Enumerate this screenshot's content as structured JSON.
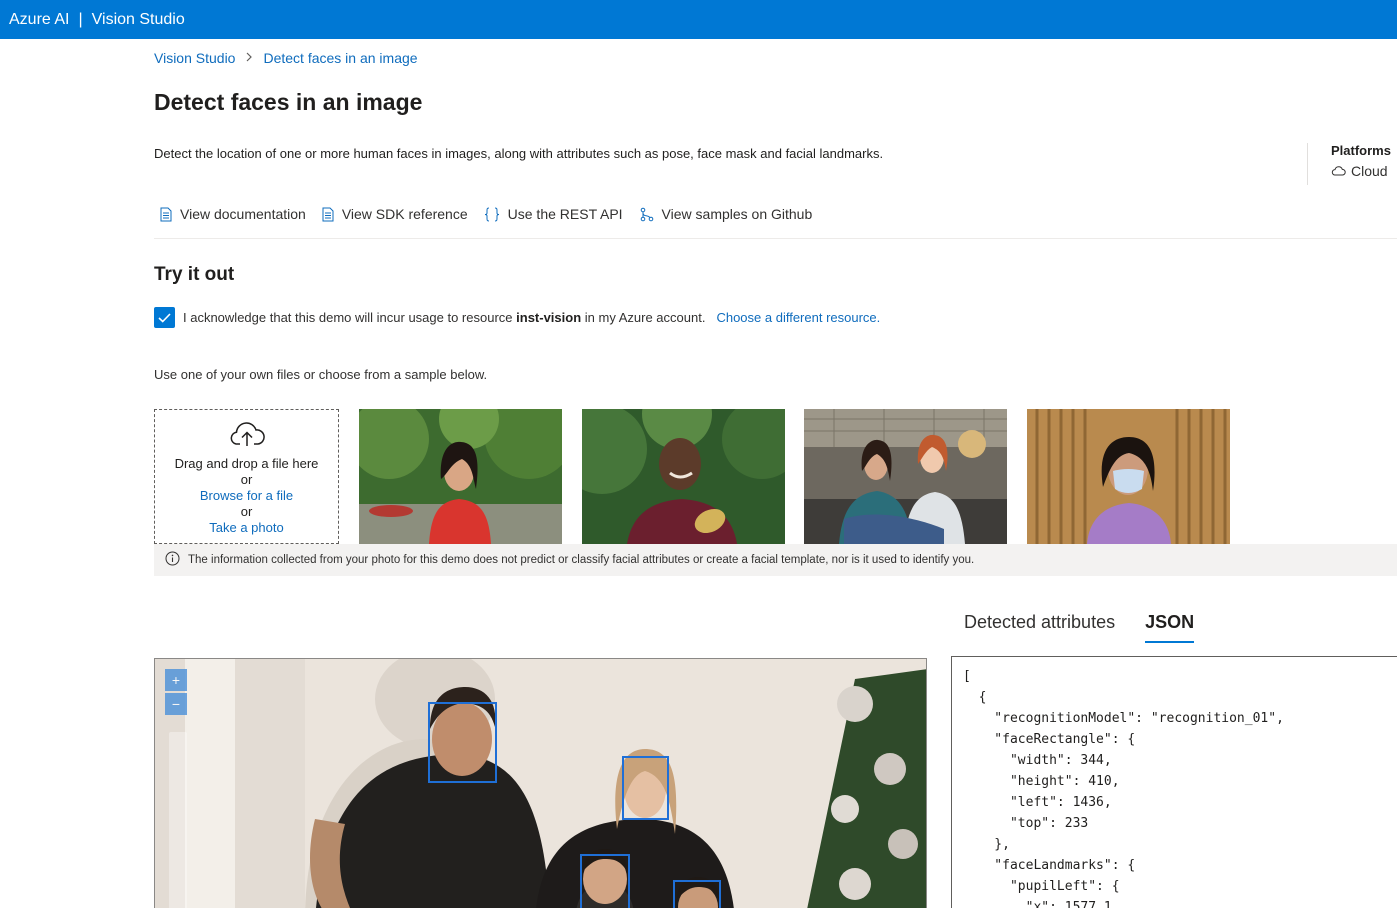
{
  "topbar": {
    "brand": "Azure AI",
    "separator": "|",
    "product": "Vision Studio"
  },
  "breadcrumb": {
    "root": "Vision Studio",
    "current": "Detect faces in an image"
  },
  "page": {
    "title": "Detect faces in an image",
    "description": "Detect the location of one or more human faces in images, along with attributes such as pose, face mask and facial landmarks."
  },
  "platforms": {
    "label": "Platforms",
    "value": "Cloud"
  },
  "links": {
    "documentation": "View documentation",
    "sdk": "View SDK reference",
    "rest": "Use the REST API",
    "github": "View samples on Github"
  },
  "try": {
    "title": "Try it out",
    "ack_prefix": "I acknowledge that this demo will incur usage to resource",
    "ack_resource": "inst-vision",
    "ack_suffix": "in my Azure account.",
    "choose_link": "Choose a different resource.",
    "acknowledged": true,
    "use_files": "Use one of your own files or choose from a sample below."
  },
  "dropzone": {
    "drag": "Drag and drop a file here",
    "or1": "or",
    "browse": "Browse for a file",
    "or2": "or",
    "photo": "Take a photo"
  },
  "info": "The information collected from your photo for this demo does not predict or classify facial attributes or create a facial template, nor is it used to identify you.",
  "tabs": {
    "attributes": "Detected attributes",
    "json": "JSON",
    "active": "JSON"
  },
  "zoom": {
    "plus": "+",
    "minus": "−"
  },
  "json_text": "[\n  {\n    \"recognitionModel\": \"recognition_01\",\n    \"faceRectangle\": {\n      \"width\": 344,\n      \"height\": 410,\n      \"left\": 1436,\n      \"top\": 233\n    },\n    \"faceLandmarks\": {\n      \"pupilLeft\": {\n        \"x\": 1577.1,",
  "colors": {
    "brand": "#0078d4",
    "link": "#0f6cbd",
    "face_box": "#1f6fd6"
  }
}
